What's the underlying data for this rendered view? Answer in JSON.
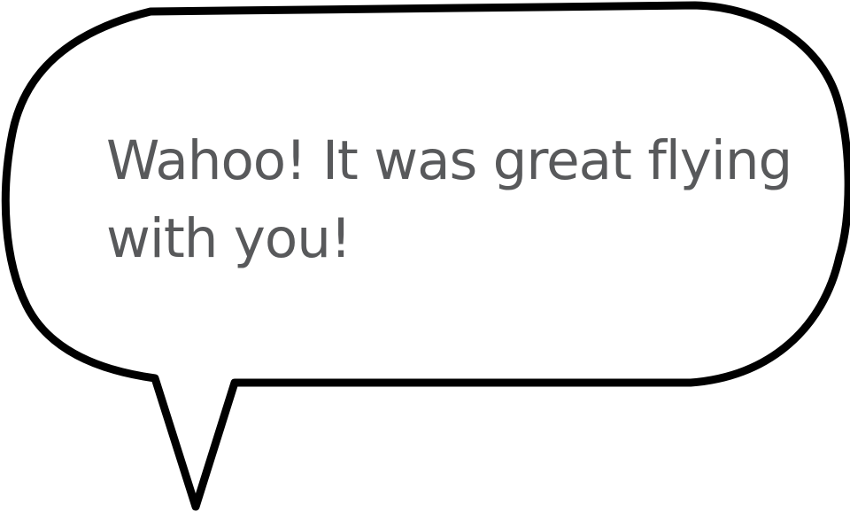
{
  "speech_bubble": {
    "text_lines": [
      "Wahoo! It was great flying",
      "with you!"
    ]
  },
  "colors": {
    "background": "#ffffff",
    "outline": "#000000",
    "text": "#58595b"
  }
}
